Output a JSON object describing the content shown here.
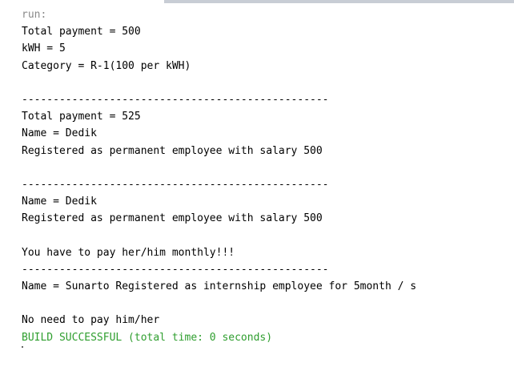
{
  "output": {
    "lines": [
      {
        "text": "run:",
        "kind": "run"
      },
      {
        "text": "Total payment = 500",
        "kind": "text"
      },
      {
        "text": "kWH = 5",
        "kind": "text"
      },
      {
        "text": "Category = R-1(100 per kWH)",
        "kind": "text"
      },
      {
        "text": "",
        "kind": "text"
      },
      {
        "text": "-------------------------------------------------",
        "kind": "text"
      },
      {
        "text": "Total payment = 525",
        "kind": "text"
      },
      {
        "text": "Name = Dedik",
        "kind": "text"
      },
      {
        "text": "Registered as permanent employee with salary 500",
        "kind": "text"
      },
      {
        "text": "",
        "kind": "text"
      },
      {
        "text": "-------------------------------------------------",
        "kind": "text"
      },
      {
        "text": "Name = Dedik",
        "kind": "text"
      },
      {
        "text": "Registered as permanent employee with salary 500",
        "kind": "text"
      },
      {
        "text": "",
        "kind": "text"
      },
      {
        "text": "You have to pay her/him monthly!!!",
        "kind": "text"
      },
      {
        "text": "-------------------------------------------------",
        "kind": "text"
      },
      {
        "text": "Name = Sunarto Registered as internship employee for 5month / s",
        "kind": "text"
      },
      {
        "text": "",
        "kind": "text"
      },
      {
        "text": "No need to pay him/her",
        "kind": "text"
      },
      {
        "text": "BUILD SUCCESSFUL (total time: 0 seconds)",
        "kind": "build"
      }
    ]
  },
  "colors": {
    "run_text": "#8a8a8a",
    "build_success": "#2e9e2e",
    "body_text": "#000000",
    "background": "#ffffff"
  }
}
